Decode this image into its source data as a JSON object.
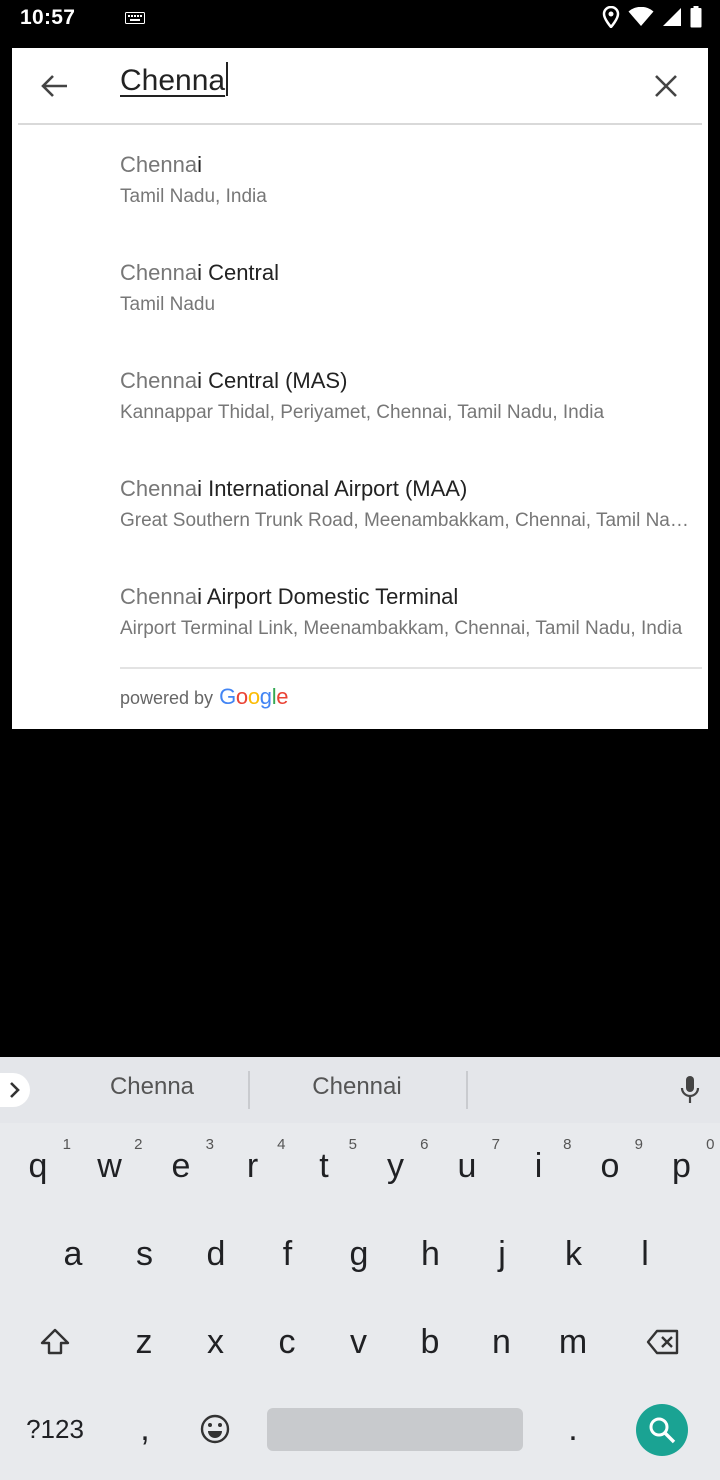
{
  "status_bar": {
    "time": "10:57",
    "icons": [
      "keyboard-icon",
      "location-icon",
      "wifi-icon",
      "signal-icon",
      "battery-icon"
    ]
  },
  "search": {
    "query": "Chenna",
    "back_icon": "arrow-left-icon",
    "clear_icon": "close-icon"
  },
  "results": [
    {
      "match": "Chenna",
      "rest": "i",
      "subtitle": "Tamil Nadu, India"
    },
    {
      "match": "Chenna",
      "rest": "i Central",
      "subtitle": "Tamil Nadu"
    },
    {
      "match": "Chenna",
      "rest": "i Central (MAS)",
      "subtitle": "Kannappar Thidal, Periyamet, Chennai, Tamil Nadu, India"
    },
    {
      "match": "Chenna",
      "rest": "i International Airport (MAA)",
      "subtitle": "Great Southern Trunk Road, Meenambakkam, Chennai, Tamil Nadu, India"
    },
    {
      "match": "Chenna",
      "rest": "i Airport Domestic Terminal",
      "subtitle": "Airport Terminal Link, Meenambakkam, Chennai, Tamil Nadu, India"
    }
  ],
  "attribution": {
    "text": "powered by",
    "logo_letters": [
      {
        "ch": "G",
        "color": "#4285F4"
      },
      {
        "ch": "o",
        "color": "#EA4335"
      },
      {
        "ch": "o",
        "color": "#FBBC05"
      },
      {
        "ch": "g",
        "color": "#4285F4"
      },
      {
        "ch": "l",
        "color": "#34A853"
      },
      {
        "ch": "e",
        "color": "#EA4335"
      }
    ]
  },
  "keyboard": {
    "suggestions": [
      "Chenna",
      "Chennai"
    ],
    "row1": [
      {
        "key": "q",
        "hint": "1"
      },
      {
        "key": "w",
        "hint": "2"
      },
      {
        "key": "e",
        "hint": "3"
      },
      {
        "key": "r",
        "hint": "4"
      },
      {
        "key": "t",
        "hint": "5"
      },
      {
        "key": "y",
        "hint": "6"
      },
      {
        "key": "u",
        "hint": "7"
      },
      {
        "key": "i",
        "hint": "8"
      },
      {
        "key": "o",
        "hint": "9"
      },
      {
        "key": "p",
        "hint": "0"
      }
    ],
    "row2": [
      "a",
      "s",
      "d",
      "f",
      "g",
      "h",
      "j",
      "k",
      "l"
    ],
    "row3": [
      "z",
      "x",
      "c",
      "v",
      "b",
      "n",
      "m"
    ],
    "symbols_label": "?123",
    "comma_label": ",",
    "period_label": ".",
    "accent_color": "#1aa393"
  }
}
